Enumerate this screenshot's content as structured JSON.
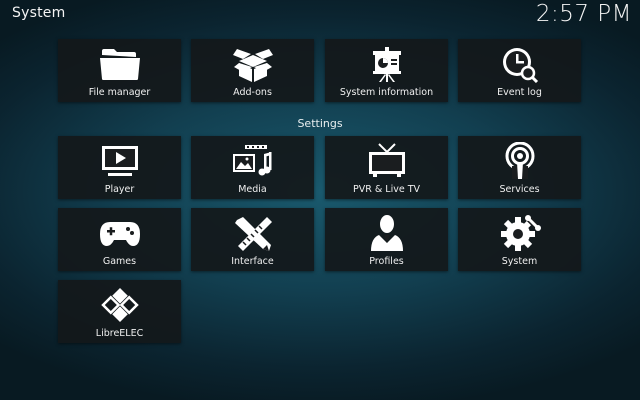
{
  "header": {
    "title": "System",
    "clock": "2:57 PM"
  },
  "top_row": [
    {
      "label": "File manager",
      "icon": "folder-icon"
    },
    {
      "label": "Add-ons",
      "icon": "open-box-icon"
    },
    {
      "label": "System information",
      "icon": "presentation-board-icon"
    },
    {
      "label": "Event log",
      "icon": "clock-search-icon"
    }
  ],
  "settings": {
    "heading": "Settings",
    "items": [
      {
        "label": "Player",
        "icon": "play-screen-icon"
      },
      {
        "label": "Media",
        "icon": "media-icon"
      },
      {
        "label": "PVR & Live TV",
        "icon": "tv-antenna-icon"
      },
      {
        "label": "Services",
        "icon": "broadcast-icon"
      },
      {
        "label": "Games",
        "icon": "gamepad-icon"
      },
      {
        "label": "Interface",
        "icon": "pencil-ruler-icon"
      },
      {
        "label": "Profiles",
        "icon": "user-silhouette-icon"
      },
      {
        "label": "System",
        "icon": "gear-wrench-icon"
      },
      {
        "label": "LibreELEC",
        "icon": "libreelec-logo-icon"
      }
    ]
  }
}
